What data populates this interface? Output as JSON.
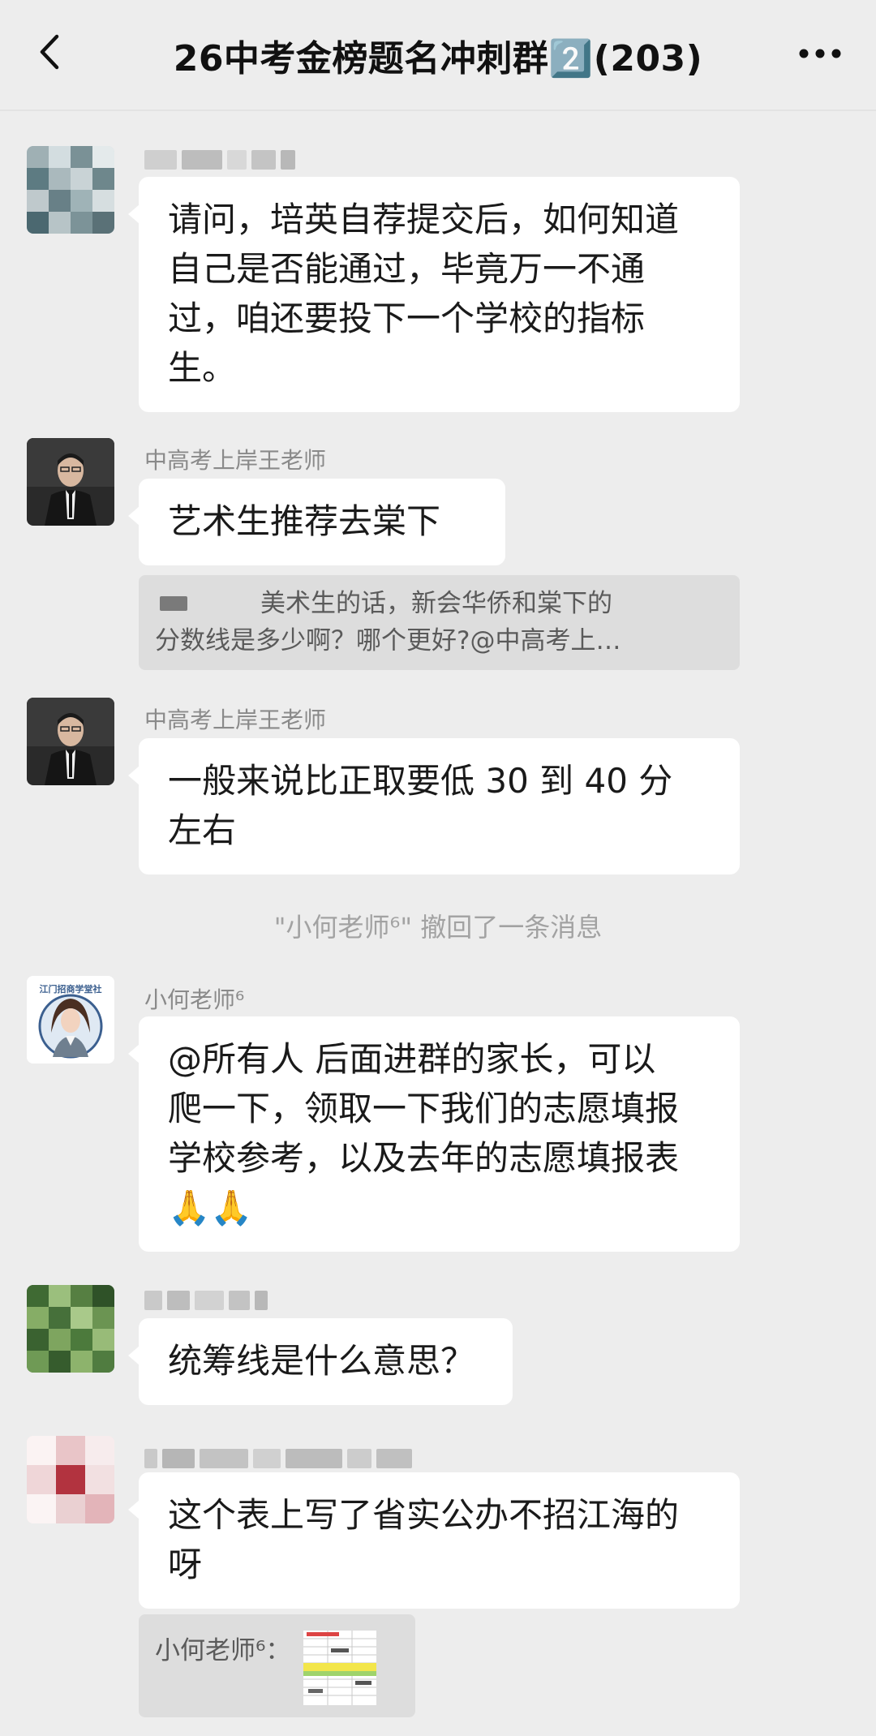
{
  "header": {
    "title": "26中考金榜题名冲刺群2️⃣(203)",
    "back_icon": "chevron-left-icon",
    "more_icon": "more-dots-icon"
  },
  "messages": [
    {
      "sender": "",
      "text_lines": [
        "请问，培英自荐提交后，如何知道",
        "自己是否能通过，毕竟万一不通",
        "过，咱还要投下一个学校的指标",
        "生。"
      ]
    },
    {
      "sender": "中高考上岸王老师",
      "text_lines": [
        "艺术生推荐去棠下"
      ],
      "quote_lines": [
        "美术生的话，新会华侨和棠下的",
        "分数线是多少啊？哪个更好?@中高考上…"
      ]
    },
    {
      "sender": "中高考上岸王老师",
      "text_lines": [
        "一般来说比正取要低 30 到 40 分",
        "左右"
      ]
    },
    {
      "sender": "小何老师⁶",
      "avatar_caption": "江门招商学堂社",
      "text_lines": [
        "@所有人  后面进群的家长，可以",
        "爬一下，领取一下我们的志愿填报",
        "学校参考，以及去年的志愿填报表",
        "🙏🙏"
      ]
    },
    {
      "sender": "",
      "text_lines": [
        "统筹线是什么意思？"
      ]
    },
    {
      "sender": "",
      "text_lines": [
        "这个表上写了省实公办不招江海的",
        "呀"
      ],
      "quote_label": "小何老师⁶："
    }
  ],
  "system": {
    "recall_text": "\"小何老师⁶\" 撤回了一条消息"
  },
  "colors": {
    "background": "#ededed",
    "bubble": "#ffffff",
    "quote_bg": "#dddddd",
    "name": "#8a8a8a",
    "system_text": "#a2a2a2"
  }
}
